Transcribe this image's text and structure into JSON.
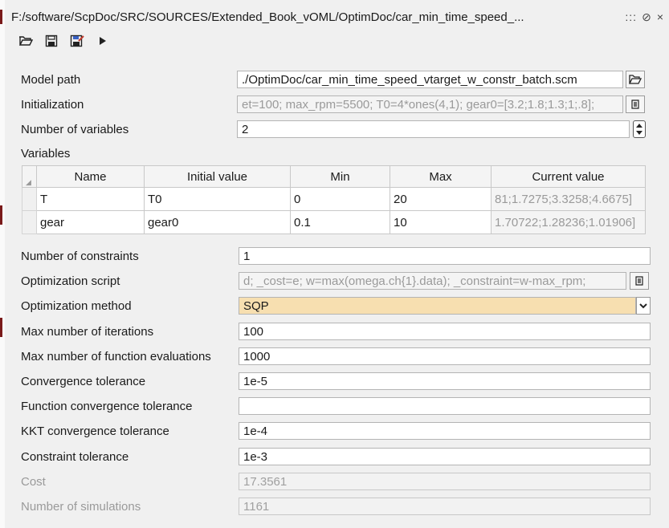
{
  "window": {
    "title": "F:/software/ScpDoc/SRC/SOURCES/Extended_Book_vOML/OptimDoc/car_min_time_speed_...",
    "controls": [
      "::: ",
      "⊘",
      "×"
    ]
  },
  "toolbar": {
    "icons": [
      "folder-open-icon",
      "save-icon",
      "save-as-icon",
      "run-icon"
    ]
  },
  "model_path": {
    "label": "Model path",
    "value": "./OptimDoc/car_min_time_speed_vtarget_w_constr_batch.scm"
  },
  "initialization": {
    "label": "Initialization",
    "value": "et=100; max_rpm=5500; T0=4*ones(4,1); gear0=[3.2;1.8;1.3;1;.8];"
  },
  "num_variables": {
    "label": "Number of variables",
    "value": "2"
  },
  "variables": {
    "label": "Variables",
    "columns": [
      "Name",
      "Initial value",
      "Min",
      "Max",
      "Current value"
    ],
    "rows": [
      [
        "T",
        "T0",
        "0",
        "20",
        "81;1.7275;3.3258;4.6675]"
      ],
      [
        "gear",
        "gear0",
        "0.1",
        "10",
        "1.70722;1.28236;1.01906]"
      ]
    ]
  },
  "num_constraints": {
    "label": "Number of constraints",
    "value": "1"
  },
  "opt_script": {
    "label": "Optimization script",
    "value": "d; _cost=e; w=max(omega.ch{1}.data); _constraint=w-max_rpm;"
  },
  "opt_method": {
    "label": "Optimization method",
    "value": "SQP"
  },
  "max_iter": {
    "label": "Max number of iterations",
    "value": "100"
  },
  "max_fev": {
    "label": "Max number of function evaluations",
    "value": "1000"
  },
  "conv_tol": {
    "label": "Convergence tolerance",
    "value": "1e-5"
  },
  "fconv_tol": {
    "label": "Function convergence tolerance",
    "value": ""
  },
  "kkt_tol": {
    "label": "KKT convergence tolerance",
    "value": "1e-4"
  },
  "constr_tol": {
    "label": "Constraint tolerance",
    "value": "1e-3"
  },
  "cost": {
    "label": "Cost",
    "value": "17.3561"
  },
  "num_sims": {
    "label": "Number of simulations",
    "value": "1161"
  },
  "colors": {
    "select_bg": "#f7dfb0",
    "left_marker": "#7a1a1a"
  }
}
